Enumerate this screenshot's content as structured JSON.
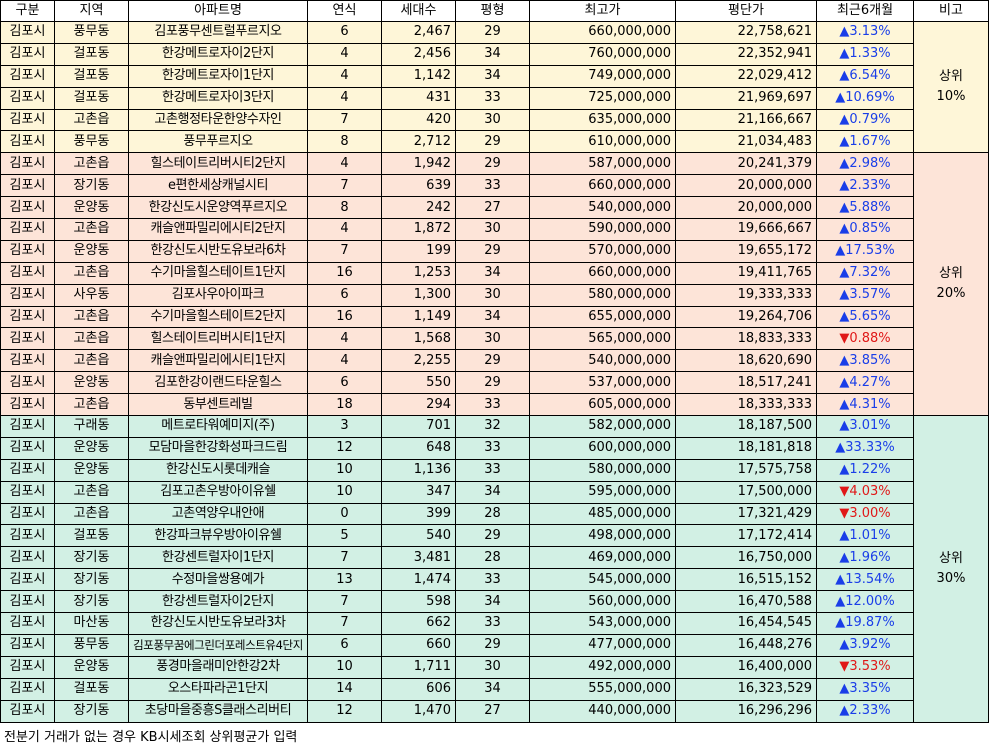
{
  "headers": [
    "구분",
    "지역",
    "아파트명",
    "연식",
    "세대수",
    "평형",
    "최고가",
    "평단가",
    "최근6개월",
    "비고"
  ],
  "groups": [
    {
      "note_line1": "상위",
      "note_line2": "10%",
      "rows": [
        [
          "김포시",
          "풍무동",
          "김포풍무센트럴푸르지오",
          "6",
          "2,467",
          "29",
          "660,000,000",
          "22,758,621",
          "▲3.13%",
          "up"
        ],
        [
          "김포시",
          "걸포동",
          "한강메트로자이2단지",
          "4",
          "2,456",
          "34",
          "760,000,000",
          "22,352,941",
          "▲1.33%",
          "up"
        ],
        [
          "김포시",
          "걸포동",
          "한강메트로자이1단지",
          "4",
          "1,142",
          "34",
          "749,000,000",
          "22,029,412",
          "▲6.54%",
          "up"
        ],
        [
          "김포시",
          "걸포동",
          "한강메트로자이3단지",
          "4",
          "431",
          "33",
          "725,000,000",
          "21,969,697",
          "▲10.69%",
          "up"
        ],
        [
          "김포시",
          "고촌읍",
          "고촌행정타운한양수자인",
          "7",
          "420",
          "30",
          "635,000,000",
          "21,166,667",
          "▲0.79%",
          "up"
        ],
        [
          "김포시",
          "풍무동",
          "풍무푸르지오",
          "8",
          "2,712",
          "29",
          "610,000,000",
          "21,034,483",
          "▲1.67%",
          "up"
        ]
      ]
    },
    {
      "note_line1": "상위",
      "note_line2": "20%",
      "rows": [
        [
          "김포시",
          "고촌읍",
          "힐스테이트리버시티2단지",
          "4",
          "1,942",
          "29",
          "587,000,000",
          "20,241,379",
          "▲2.98%",
          "up"
        ],
        [
          "김포시",
          "장기동",
          "e편한세상캐널시티",
          "7",
          "639",
          "33",
          "660,000,000",
          "20,000,000",
          "▲2.33%",
          "up"
        ],
        [
          "김포시",
          "운양동",
          "한강신도시운양역푸르지오",
          "8",
          "242",
          "27",
          "540,000,000",
          "20,000,000",
          "▲5.88%",
          "up"
        ],
        [
          "김포시",
          "고촌읍",
          "캐슬앤파밀리에시티2단지",
          "4",
          "1,872",
          "30",
          "590,000,000",
          "19,666,667",
          "▲0.85%",
          "up"
        ],
        [
          "김포시",
          "운양동",
          "한강신도시반도유보라6차",
          "7",
          "199",
          "29",
          "570,000,000",
          "19,655,172",
          "▲17.53%",
          "up"
        ],
        [
          "김포시",
          "고촌읍",
          "수기마을힐스테이트1단지",
          "16",
          "1,253",
          "34",
          "660,000,000",
          "19,411,765",
          "▲7.32%",
          "up"
        ],
        [
          "김포시",
          "사우동",
          "김포사우아이파크",
          "6",
          "1,300",
          "30",
          "580,000,000",
          "19,333,333",
          "▲3.57%",
          "up"
        ],
        [
          "김포시",
          "고촌읍",
          "수기마을힐스테이트2단지",
          "16",
          "1,149",
          "34",
          "655,000,000",
          "19,264,706",
          "▲5.65%",
          "up"
        ],
        [
          "김포시",
          "고촌읍",
          "힐스테이트리버시티1단지",
          "4",
          "1,568",
          "30",
          "565,000,000",
          "18,833,333",
          "▼0.88%",
          "down"
        ],
        [
          "김포시",
          "고촌읍",
          "캐슬앤파밀리에시티1단지",
          "4",
          "2,255",
          "29",
          "540,000,000",
          "18,620,690",
          "▲3.85%",
          "up"
        ],
        [
          "김포시",
          "운양동",
          "김포한강이랜드타운힐스",
          "6",
          "550",
          "29",
          "537,000,000",
          "18,517,241",
          "▲4.27%",
          "up"
        ],
        [
          "김포시",
          "고촌읍",
          "동부센트레빌",
          "18",
          "294",
          "33",
          "605,000,000",
          "18,333,333",
          "▲4.31%",
          "up"
        ]
      ]
    },
    {
      "note_line1": "상위",
      "note_line2": "30%",
      "rows": [
        [
          "김포시",
          "구래동",
          "메트로타워예미지(주)",
          "3",
          "701",
          "32",
          "582,000,000",
          "18,187,500",
          "▲3.01%",
          "up"
        ],
        [
          "김포시",
          "운양동",
          "모담마을한강화성파크드림",
          "12",
          "648",
          "33",
          "600,000,000",
          "18,181,818",
          "▲33.33%",
          "up"
        ],
        [
          "김포시",
          "운양동",
          "한강신도시롯데캐슬",
          "10",
          "1,136",
          "33",
          "580,000,000",
          "17,575,758",
          "▲1.22%",
          "up"
        ],
        [
          "김포시",
          "고촌읍",
          "김포고촌우방아이유쉘",
          "10",
          "347",
          "34",
          "595,000,000",
          "17,500,000",
          "▼4.03%",
          "down"
        ],
        [
          "김포시",
          "고촌읍",
          "고촌역양우내안애",
          "0",
          "399",
          "28",
          "485,000,000",
          "17,321,429",
          "▼3.00%",
          "down"
        ],
        [
          "김포시",
          "걸포동",
          "한강파크뷰우방아이유쉘",
          "5",
          "540",
          "29",
          "498,000,000",
          "17,172,414",
          "▲1.01%",
          "up"
        ],
        [
          "김포시",
          "장기동",
          "한강센트럴자이1단지",
          "7",
          "3,481",
          "28",
          "469,000,000",
          "16,750,000",
          "▲1.96%",
          "up"
        ],
        [
          "김포시",
          "장기동",
          "수정마을쌍용예가",
          "13",
          "1,474",
          "33",
          "545,000,000",
          "16,515,152",
          "▲13.54%",
          "up"
        ],
        [
          "김포시",
          "장기동",
          "한강센트럴자이2단지",
          "7",
          "598",
          "34",
          "560,000,000",
          "16,470,588",
          "▲12.00%",
          "up"
        ],
        [
          "김포시",
          "마산동",
          "한강신도시반도유보라3차",
          "7",
          "662",
          "33",
          "543,000,000",
          "16,454,545",
          "▲19.87%",
          "up"
        ],
        [
          "김포시",
          "풍무동",
          "김포풍무꿈에그린더포레스트유4단지",
          "6",
          "660",
          "29",
          "477,000,000",
          "16,448,276",
          "▲3.92%",
          "up"
        ],
        [
          "김포시",
          "운양동",
          "풍경마을래미안한강2차",
          "10",
          "1,711",
          "30",
          "492,000,000",
          "16,400,000",
          "▼3.53%",
          "down"
        ],
        [
          "김포시",
          "걸포동",
          "오스타파라곤1단지",
          "14",
          "606",
          "34",
          "555,000,000",
          "16,323,529",
          "▲3.35%",
          "up"
        ],
        [
          "김포시",
          "장기동",
          "초당마을중흥S클래스리버티",
          "12",
          "1,470",
          "27",
          "440,000,000",
          "16,296,296",
          "▲2.33%",
          "up"
        ]
      ]
    }
  ],
  "colors": {
    "up": "#1a3ee8",
    "down": "#e01818",
    "group1_bg": "#fef6d8",
    "group2_bg": "#fde4d8",
    "group3_bg": "#d2f0e4"
  },
  "footnote": "전분기 거래가 없는 경우 KB시세조회 상위평균가 입력"
}
